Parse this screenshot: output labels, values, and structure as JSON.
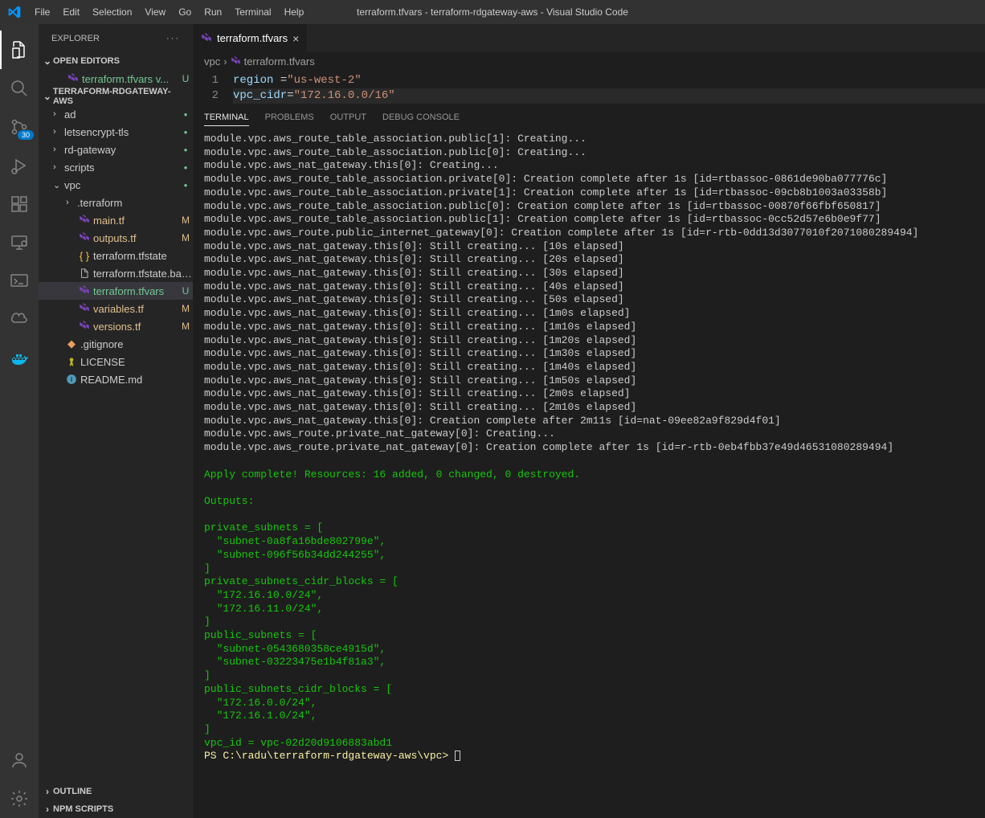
{
  "window": {
    "title": "terraform.tfvars - terraform-rdgateway-aws - Visual Studio Code"
  },
  "menu": [
    "File",
    "Edit",
    "Selection",
    "View",
    "Go",
    "Run",
    "Terminal",
    "Help"
  ],
  "activitybar": {
    "scm_badge": "30"
  },
  "sidebar": {
    "title": "EXPLORER",
    "open_editors_label": "OPEN EDITORS",
    "open_editors": [
      {
        "name": "terraform.tfvars",
        "detail": "v...",
        "status": "U"
      }
    ],
    "workspace_label": "TERRAFORM-RDGATEWAY-AWS",
    "tree": [
      {
        "type": "folder",
        "name": "ad",
        "status": "dot",
        "indent": 1
      },
      {
        "type": "folder",
        "name": "letsencrypt-tls",
        "status": "dot",
        "indent": 1
      },
      {
        "type": "folder",
        "name": "rd-gateway",
        "status": "dot",
        "indent": 1
      },
      {
        "type": "folder",
        "name": "scripts",
        "status": "dot",
        "indent": 1
      },
      {
        "type": "folder",
        "name": "vpc",
        "expanded": true,
        "status": "dot",
        "indent": 1
      },
      {
        "type": "folder",
        "name": ".terraform",
        "indent": 2
      },
      {
        "type": "file",
        "icon": "tf",
        "name": "main.tf",
        "status": "M",
        "indent": 2
      },
      {
        "type": "file",
        "icon": "tf",
        "name": "outputs.tf",
        "status": "M",
        "indent": 2
      },
      {
        "type": "file",
        "icon": "json",
        "name": "terraform.tfstate",
        "indent": 2
      },
      {
        "type": "file",
        "icon": "file",
        "name": "terraform.tfstate.backup",
        "indent": 2
      },
      {
        "type": "file",
        "icon": "tf",
        "name": "terraform.tfvars",
        "status": "U",
        "selected": true,
        "indent": 2
      },
      {
        "type": "file",
        "icon": "tf",
        "name": "variables.tf",
        "status": "M",
        "indent": 2
      },
      {
        "type": "file",
        "icon": "tf",
        "name": "versions.tf",
        "status": "M",
        "indent": 2
      },
      {
        "type": "file",
        "icon": "git",
        "name": ".gitignore",
        "indent": 1
      },
      {
        "type": "file",
        "icon": "license",
        "name": "LICENSE",
        "indent": 1
      },
      {
        "type": "file",
        "icon": "info",
        "name": "README.md",
        "indent": 1
      }
    ],
    "outline_label": "OUTLINE",
    "npm_label": "NPM SCRIPTS"
  },
  "editor": {
    "tab_label": "terraform.tfvars",
    "breadcrumbs": [
      "vpc",
      "terraform.tfvars"
    ],
    "lines": [
      {
        "n": "1",
        "var": "region ",
        "op": "=",
        "str": "\"us-west-2\""
      },
      {
        "n": "2",
        "var": "vpc_cidr",
        "op": "=",
        "str": "\"172.16.0.0/16\""
      }
    ]
  },
  "panel": {
    "tabs": [
      "TERMINAL",
      "PROBLEMS",
      "OUTPUT",
      "DEBUG CONSOLE"
    ],
    "active": 0,
    "terminal_lines": [
      "module.vpc.aws_route_table_association.public[1]: Creating...",
      "module.vpc.aws_route_table_association.public[0]: Creating...",
      "module.vpc.aws_nat_gateway.this[0]: Creating...",
      "module.vpc.aws_route_table_association.private[0]: Creation complete after 1s [id=rtbassoc-0861de90ba077776c]",
      "module.vpc.aws_route_table_association.private[1]: Creation complete after 1s [id=rtbassoc-09cb8b1003a03358b]",
      "module.vpc.aws_route_table_association.public[0]: Creation complete after 1s [id=rtbassoc-00870f66fbf650817]",
      "module.vpc.aws_route_table_association.public[1]: Creation complete after 1s [id=rtbassoc-0cc52d57e6b0e9f77]",
      "module.vpc.aws_route.public_internet_gateway[0]: Creation complete after 1s [id=r-rtb-0dd13d3077010f2071080289494]",
      "module.vpc.aws_nat_gateway.this[0]: Still creating... [10s elapsed]",
      "module.vpc.aws_nat_gateway.this[0]: Still creating... [20s elapsed]",
      "module.vpc.aws_nat_gateway.this[0]: Still creating... [30s elapsed]",
      "module.vpc.aws_nat_gateway.this[0]: Still creating... [40s elapsed]",
      "module.vpc.aws_nat_gateway.this[0]: Still creating... [50s elapsed]",
      "module.vpc.aws_nat_gateway.this[0]: Still creating... [1m0s elapsed]",
      "module.vpc.aws_nat_gateway.this[0]: Still creating... [1m10s elapsed]",
      "module.vpc.aws_nat_gateway.this[0]: Still creating... [1m20s elapsed]",
      "module.vpc.aws_nat_gateway.this[0]: Still creating... [1m30s elapsed]",
      "module.vpc.aws_nat_gateway.this[0]: Still creating... [1m40s elapsed]",
      "module.vpc.aws_nat_gateway.this[0]: Still creating... [1m50s elapsed]",
      "module.vpc.aws_nat_gateway.this[0]: Still creating... [2m0s elapsed]",
      "module.vpc.aws_nat_gateway.this[0]: Still creating... [2m10s elapsed]",
      "module.vpc.aws_nat_gateway.this[0]: Creation complete after 2m11s [id=nat-09ee82a9f829d4f01]",
      "module.vpc.aws_route.private_nat_gateway[0]: Creating...",
      "module.vpc.aws_route.private_nat_gateway[0]: Creation complete after 1s [id=r-rtb-0eb4fbb37e49d46531080289494]"
    ],
    "terminal_green": [
      "",
      "Apply complete! Resources: 16 added, 0 changed, 0 destroyed.",
      "",
      "Outputs:",
      "",
      "private_subnets = [",
      "  \"subnet-0a8fa16bde802799e\",",
      "  \"subnet-096f56b34dd244255\",",
      "]",
      "private_subnets_cidr_blocks = [",
      "  \"172.16.10.0/24\",",
      "  \"172.16.11.0/24\",",
      "]",
      "public_subnets = [",
      "  \"subnet-0543680358ce4915d\",",
      "  \"subnet-03223475e1b4f81a3\",",
      "]",
      "public_subnets_cidr_blocks = [",
      "  \"172.16.0.0/24\",",
      "  \"172.16.1.0/24\",",
      "]",
      "vpc_id = vpc-02d20d9106883abd1"
    ],
    "prompt_prefix": "PS ",
    "prompt_path": "C:\\radu\\terraform-rdgateway-aws\\vpc>"
  }
}
